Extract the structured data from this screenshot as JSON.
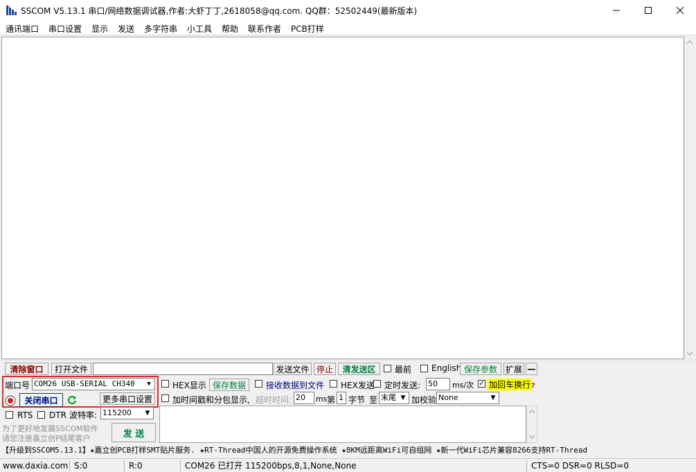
{
  "window": {
    "title": "SSCOM V5.13.1 串口/网络数据调试器,作者:大虾丁丁,2618058@qq.com. QQ群：52502449(最新版本)"
  },
  "menu": [
    "通讯端口",
    "串口设置",
    "显示",
    "发送",
    "多字符串",
    "小工具",
    "帮助",
    "联系作者",
    "PCB打样"
  ],
  "toolbar": {
    "clear_window": "清除窗口",
    "open_file": "打开文件",
    "file_path": "",
    "send_file": "发送文件",
    "stop": "停止",
    "clear_send": "清发送区",
    "topmost": "最前",
    "english": "English",
    "save_params": "保存参数",
    "expand": "扩展",
    "collapse": "—"
  },
  "port": {
    "label": "端口号",
    "value": "COM26 USB-SERIAL CH340",
    "close_btn": "关闭串口",
    "more_settings": "更多串口设置",
    "rts": "RTS",
    "dtr": "DTR",
    "baud_label": "波特率:",
    "baud_value": "115200"
  },
  "options": {
    "hex_display": "HEX显示",
    "save_data": "保存数据",
    "recv_to_file": "接收数据到文件",
    "hex_send": "HEX发送",
    "timed_send": "定时发送:",
    "interval": "50",
    "interval_unit": "ms/次",
    "add_crlf": "加回车换行",
    "help_mark": "?",
    "timestamp": "加时间戳和分包显示,",
    "timeout_label": "超时时间:",
    "timeout_value": "20",
    "timeout_unit": "ms",
    "byte_label_pre": "第",
    "byte_value": "1",
    "byte_label_post": "字节",
    "to_label": "至",
    "end_value": "末尾",
    "checksum_label": "加校验",
    "checksum_value": "None"
  },
  "promo": {
    "line1": "为了更好地发展SSCOM软件",
    "line2": "请您注册嘉立创P结尾客户",
    "send_btn": "发 送"
  },
  "ticker": "【升级到SSCOM5.13.1】★嘉立创PCB打样SMT贴片服务. ★RT-Thread中国人的开源免费操作系统 ★8KM远距离WiFi可自组网 ★新一代WiFi芯片兼容8266支持RT-Thread",
  "status": {
    "website": "www.daxia.com",
    "sent": "S:0",
    "received": "R:0",
    "port_status": "COM26 已打开  115200bps,8,1,None,None",
    "lines": "CTS=0 DSR=0 RLSD=0"
  },
  "colors": {
    "highlight_red": "#e0282e",
    "yellow": "#ffff00",
    "dark_red_text": "#8b0000",
    "green_text": "#008040",
    "blue_text": "#000080"
  }
}
